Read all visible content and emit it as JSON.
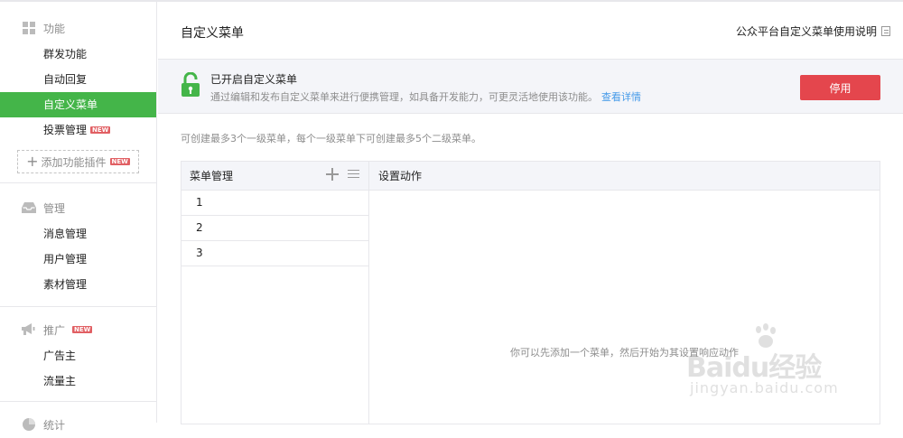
{
  "sidebar": {
    "sections": [
      {
        "title": "功能",
        "icon": "grid-icon",
        "items": [
          {
            "label": "群发功能"
          },
          {
            "label": "自动回复"
          },
          {
            "label": "自定义菜单",
            "active": true
          },
          {
            "label": "投票管理",
            "badge": "NEW"
          }
        ]
      },
      {
        "title": "管理",
        "icon": "inbox-icon",
        "items": [
          {
            "label": "消息管理"
          },
          {
            "label": "用户管理"
          },
          {
            "label": "素材管理"
          }
        ]
      },
      {
        "title": "推广",
        "icon": "megaphone-icon",
        "badge": "NEW",
        "items": [
          {
            "label": "广告主"
          },
          {
            "label": "流量主"
          }
        ]
      },
      {
        "title": "统计",
        "icon": "pie-chart-icon",
        "items": []
      }
    ],
    "add_plugin": {
      "label": "添加功能插件",
      "badge": "NEW"
    }
  },
  "header": {
    "title": "自定义菜单",
    "help_link": "公众平台自定义菜单使用说明"
  },
  "banner": {
    "title": "已开启自定义菜单",
    "description": "通过编辑和发布自定义菜单来进行便携管理，如具备开发能力，可更灵活地使用该功能。",
    "details_link": "查看详情",
    "stop_button": "停用"
  },
  "limit_tip": "可创建最多3个一级菜单，每个一级菜单下可创建最多5个二级菜单。",
  "menu_panel": {
    "left_header": "菜单管理",
    "rows": [
      "1",
      "2",
      "3"
    ],
    "right_header": "设置动作",
    "empty_tip": "你可以先添加一个菜单，然后开始为其设置响应动作"
  },
  "watermark": {
    "brand": "Baidu经验",
    "url": "jingyan.baidu.com"
  },
  "colors": {
    "active_green": "#44b549",
    "stop_red": "#e4464d",
    "link_blue": "#459ae9",
    "new_badge": "#e15f63"
  }
}
